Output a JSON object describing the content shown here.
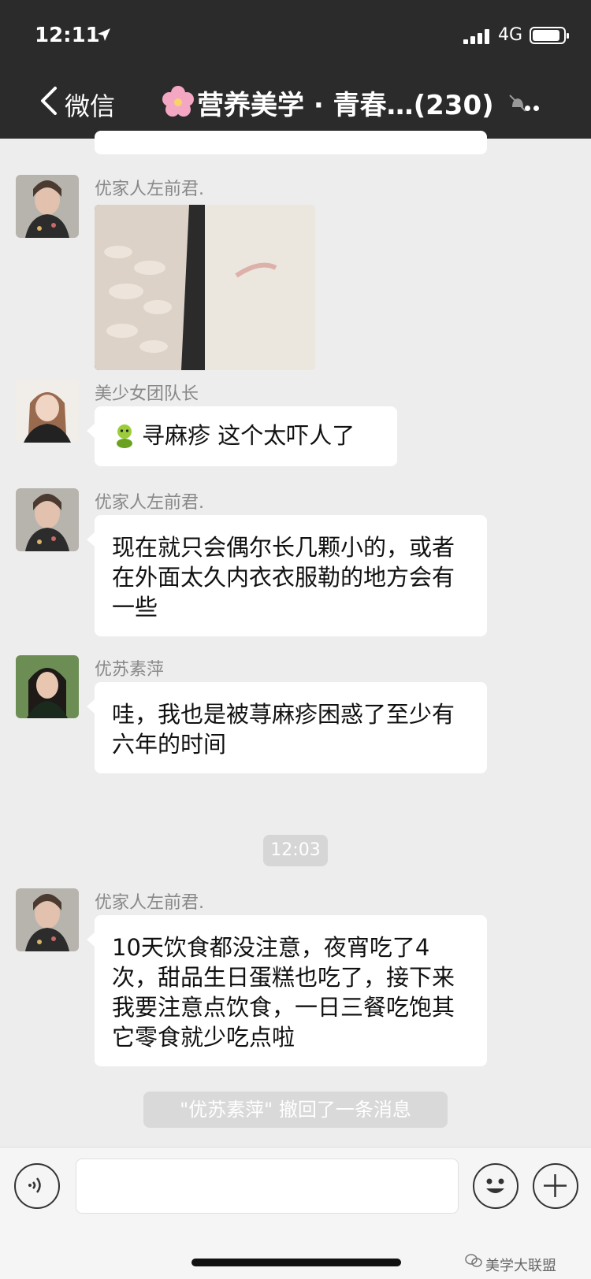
{
  "status_bar": {
    "time": "12:11",
    "network": "4G"
  },
  "nav": {
    "back_label": "微信",
    "title": "营养美学 · 青春…(230)"
  },
  "messages": [
    {
      "sender": "优家人左前君.",
      "type": "image"
    },
    {
      "sender": "美少女团队长",
      "text": "寻麻疹 这个太吓人了"
    },
    {
      "sender": "优家人左前君.",
      "text": "现在就只会偶尔长几颗小的，或者在外面太久内衣衣服勒的地方会有一些"
    },
    {
      "sender": "优苏素萍",
      "text": "哇，我也是被荨麻疹困惑了至少有六年的时间"
    },
    {
      "sender": "优家人左前君.",
      "text": "10天饮食都没注意，夜宵吃了4次，甜品生日蛋糕也吃了，接下来我要注意点饮食，一日三餐吃饱其它零食就少吃点啦"
    }
  ],
  "timestamp": "12:03",
  "recall_notice": "\"优苏素萍\" 撤回了一条消息",
  "watermark": "美学大联盟",
  "icons": [
    "location-arrow-icon",
    "signal-icon",
    "battery-icon",
    "back-chevron-icon",
    "flower-emoji-icon",
    "mute-icon",
    "more-icon",
    "voice-icon",
    "emoji-icon",
    "plus-icon"
  ]
}
